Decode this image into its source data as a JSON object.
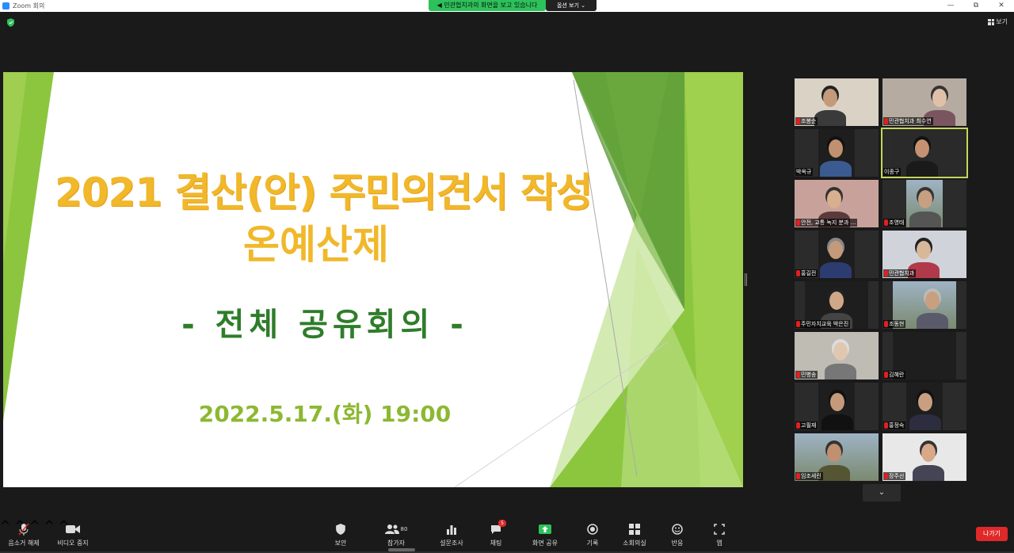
{
  "window": {
    "title": "Zoom 회의",
    "controls": [
      "—",
      "⧉",
      "✕"
    ]
  },
  "share_banner": {
    "text": "민관협치과의 화면을 보고 있습니다",
    "options_label": "옵션 보기 ⌄"
  },
  "view": {
    "label": "보기"
  },
  "slide": {
    "title_line1": "2021 결산(안) 주민의견서 작성",
    "title_line2": "온예산제",
    "subtitle": "- 전체 공유회의 -",
    "date": "2022.5.17.(화) 19:00",
    "colors": {
      "title": "#f0b82a",
      "subtitle": "#2f7d2a",
      "date": "#8cb832",
      "accent": "#8cc63f"
    }
  },
  "participants": [
    {
      "name": "조봉순",
      "muted": true
    },
    {
      "name": "민관협치과 최수연",
      "muted": true
    },
    {
      "name": "박옥규",
      "muted": false
    },
    {
      "name": "이종구",
      "muted": false,
      "active": true
    },
    {
      "name": "안전, 교통 녹지 분과 ...",
      "muted": true
    },
    {
      "name": "조영태",
      "muted": true
    },
    {
      "name": "홍길전",
      "muted": true
    },
    {
      "name": "민관협치과",
      "muted": true
    },
    {
      "name": "주민자치교육 박은진",
      "muted": true
    },
    {
      "name": "조동현",
      "muted": true
    },
    {
      "name": "민병송",
      "muted": true
    },
    {
      "name": "김혜란",
      "muted": true
    },
    {
      "name": "고필재",
      "muted": true
    },
    {
      "name": "홍정숙",
      "muted": true
    },
    {
      "name": "임조세린",
      "muted": true
    },
    {
      "name": "장주선",
      "muted": true
    }
  ],
  "toolbar": {
    "mute_label": "음소거 해제",
    "video_label": "비디오 중지",
    "security_label": "보안",
    "participants_label": "참가자",
    "participants_count": "80",
    "polls_label": "설문조사",
    "chat_label": "채팅",
    "chat_badge": "5",
    "share_label": "화면 공유",
    "record_label": "기록",
    "breakout_label": "소회의실",
    "reactions_label": "반응",
    "apps_label": "앱",
    "leave_label": "나가기"
  }
}
